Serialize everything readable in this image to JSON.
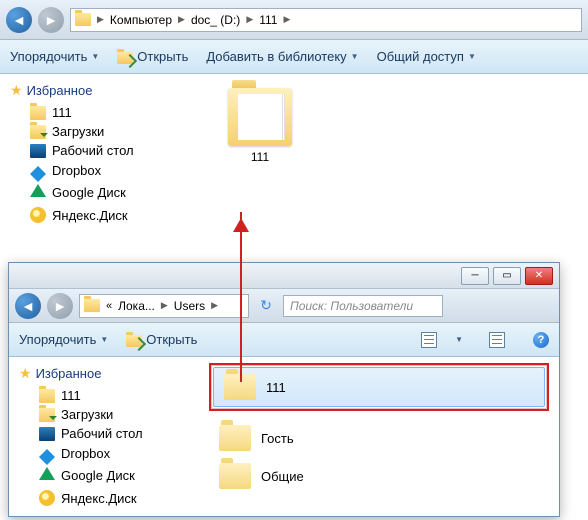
{
  "window1": {
    "breadcrumb": {
      "root": "Компьютер",
      "drive": "doc_ (D:)",
      "folder": "111"
    },
    "toolbar": {
      "organize": "Упорядочить",
      "open": "Открыть",
      "add_library": "Добавить в библиотеку",
      "share": "Общий доступ"
    },
    "sidebar": {
      "header": "Избранное",
      "items": [
        {
          "label": "111",
          "icon": "folder"
        },
        {
          "label": "Загрузки",
          "icon": "downloads"
        },
        {
          "label": "Рабочий стол",
          "icon": "desktop"
        },
        {
          "label": "Dropbox",
          "icon": "dropbox"
        },
        {
          "label": "Google Диск",
          "icon": "gdrive"
        },
        {
          "label": "Яндекс.Диск",
          "icon": "yadisk"
        }
      ]
    },
    "content": {
      "folder_name": "111"
    }
  },
  "window2": {
    "breadcrumb": {
      "seg1": "Лока...",
      "seg2": "Users"
    },
    "search_placeholder": "Поиск: Пользователи",
    "toolbar": {
      "organize": "Упорядочить",
      "open": "Открыть"
    },
    "sidebar": {
      "header": "Избранное",
      "items": [
        {
          "label": "111",
          "icon": "folder"
        },
        {
          "label": "Загрузки",
          "icon": "downloads"
        },
        {
          "label": "Рабочий стол",
          "icon": "desktop"
        },
        {
          "label": "Dropbox",
          "icon": "dropbox"
        },
        {
          "label": "Google Диск",
          "icon": "gdrive"
        },
        {
          "label": "Яндекс.Диск",
          "icon": "yadisk"
        }
      ]
    },
    "content": {
      "items": [
        {
          "label": "111",
          "selected": true,
          "highlighted": true
        },
        {
          "label": "Гость",
          "selected": false,
          "highlighted": false
        },
        {
          "label": "Общие",
          "selected": false,
          "highlighted": false
        }
      ]
    },
    "titlebar": {
      "min": "─",
      "max": "▭",
      "close": "✕"
    },
    "help": "?"
  }
}
